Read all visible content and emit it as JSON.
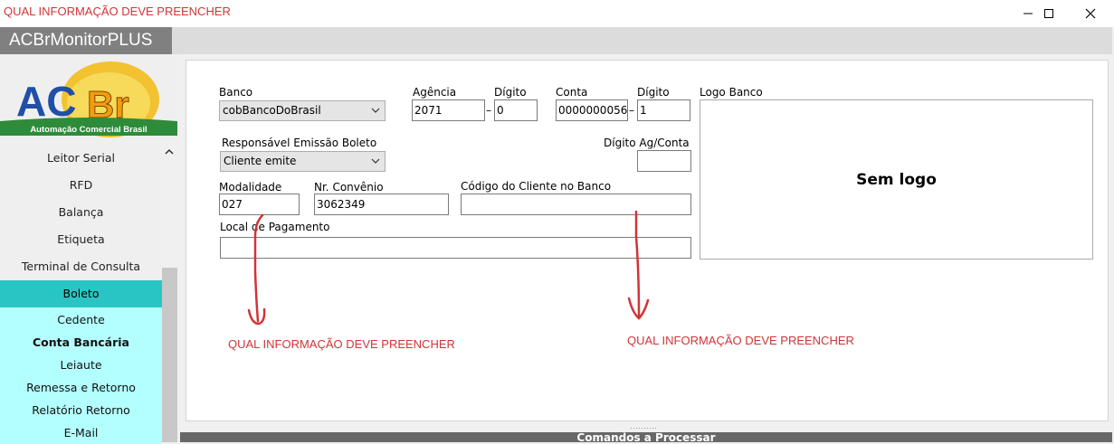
{
  "window": {
    "title": "QUAL INFORMAÇÃO DEVE PREENCHER",
    "minimize_icon": "minimize-icon",
    "maximize_icon": "maximize-icon",
    "close_icon": "close-icon"
  },
  "app": {
    "title": "ACBrMonitorPLUS"
  },
  "logo": {
    "text": "ACBr",
    "tagline": "Automação Comercial Brasil"
  },
  "sidebar": {
    "items": [
      {
        "label": "Leitor Serial"
      },
      {
        "label": "RFD"
      },
      {
        "label": "Balança"
      },
      {
        "label": "Etiqueta"
      },
      {
        "label": "Terminal de Consulta"
      },
      {
        "label": "Boleto"
      }
    ],
    "subitems": [
      {
        "label": "Cedente"
      },
      {
        "label": "Conta Bancária"
      },
      {
        "label": "Leiaute"
      },
      {
        "label": "Remessa e Retorno"
      },
      {
        "label": "Relatório Retorno"
      },
      {
        "label": "E-Mail"
      }
    ]
  },
  "form": {
    "banco_label": "Banco",
    "banco_value": "cobBancoDoBrasil",
    "agencia_label": "Agência",
    "agencia_value": "2071",
    "digito_ag_label": "Dígito",
    "digito_ag_value": "0",
    "conta_label": "Conta",
    "conta_value": "0000000056:",
    "digito_conta_label": "Dígito",
    "digito_conta_value": "1",
    "responsavel_label": "Responsável Emissão Boleto",
    "responsavel_value": "Cliente emite",
    "digito_agconta_label": "Dígito Ag/Conta",
    "digito_agconta_value": "",
    "modalidade_label": "Modalidade",
    "modalidade_value": "027",
    "convenio_label": "Nr. Convênio",
    "convenio_value": "3062349",
    "codigo_cliente_label": "Código do Cliente no Banco",
    "codigo_cliente_value": "",
    "local_pagamento_label": "Local de Pagamento",
    "local_pagamento_value": "",
    "logo_banco_label": "Logo Banco",
    "logo_banco_text": "Sem logo",
    "separator": "–"
  },
  "annotations": {
    "left": "QUAL INFORMAÇÃO DEVE PREENCHER",
    "right": "QUAL INFORMAÇÃO DEVE PREENCHER",
    "color": "#d13438"
  },
  "bottom": {
    "label": "Comandos a Processar"
  },
  "colors": {
    "active_item": "#29c5c5",
    "sub_items_bg": "#b3ffff",
    "app_title_bg": "#808080"
  }
}
